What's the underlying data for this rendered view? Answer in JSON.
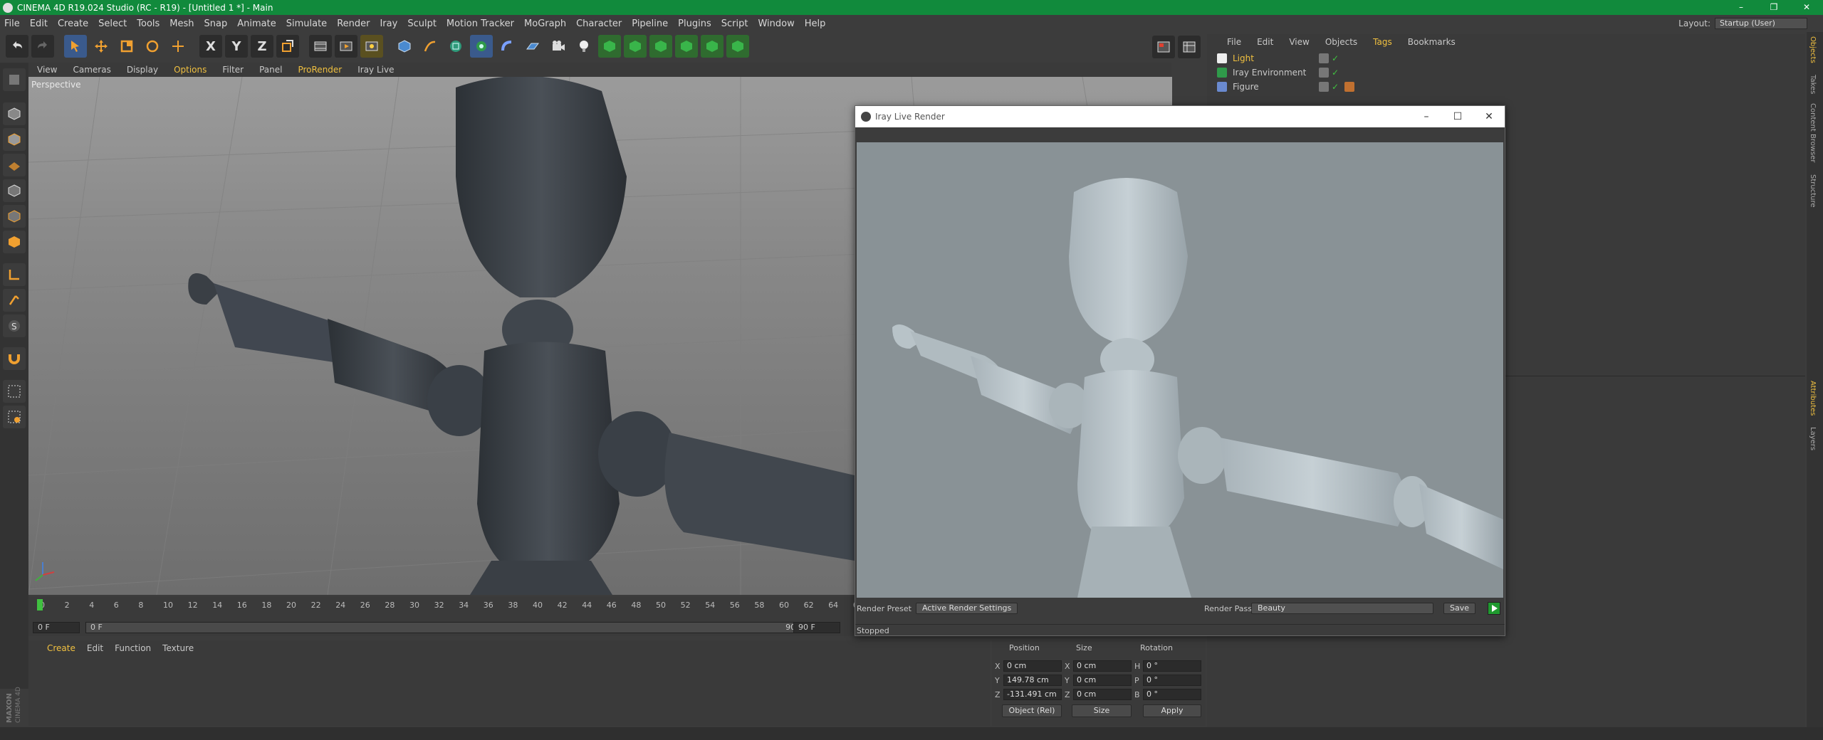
{
  "window": {
    "title": "CINEMA 4D R19.024 Studio (RC - R19) - [Untitled 1 *] - Main",
    "controls": [
      "–",
      "❐",
      "✕"
    ]
  },
  "menubar": {
    "items": [
      "File",
      "Edit",
      "Create",
      "Select",
      "Tools",
      "Mesh",
      "Snap",
      "Animate",
      "Simulate",
      "Render",
      "Iray",
      "Sculpt",
      "Motion Tracker",
      "MoGraph",
      "Character",
      "Pipeline",
      "Plugins",
      "Script",
      "Window",
      "Help"
    ],
    "layout_label": "Layout:",
    "layout_value": "Startup (User)"
  },
  "viewport": {
    "menu": [
      "View",
      "Cameras",
      "Display",
      "Options",
      "Filter",
      "Panel",
      "ProRender",
      "Iray Live"
    ],
    "label": "Perspective"
  },
  "timeline": {
    "ticks": [
      "0",
      "2",
      "4",
      "6",
      "8",
      "10",
      "12",
      "14",
      "16",
      "18",
      "20",
      "22",
      "24",
      "26",
      "28",
      "30",
      "32",
      "34",
      "36",
      "38",
      "40",
      "42",
      "44",
      "46",
      "48",
      "50",
      "52",
      "54",
      "56",
      "58",
      "60",
      "62",
      "64",
      "66"
    ],
    "current_frame": "0 F",
    "start_frame": "0 F",
    "end_frame_slider": "90 F",
    "end_frame": "90 F"
  },
  "material_panel": {
    "menu": [
      "Create",
      "Edit",
      "Function",
      "Texture"
    ]
  },
  "coordinates": {
    "headers": [
      "Position",
      "Size",
      "Rotation"
    ],
    "rows": [
      {
        "axis": "X",
        "pos": "0 cm",
        "size_axis": "X",
        "size": "0 cm",
        "rot_axis": "H",
        "rot": "0 °"
      },
      {
        "axis": "Y",
        "pos": "149.78 cm",
        "size_axis": "Y",
        "size": "0 cm",
        "rot_axis": "P",
        "rot": "0 °"
      },
      {
        "axis": "Z",
        "pos": "-131.491 cm",
        "size_axis": "Z",
        "size": "0 cm",
        "rot_axis": "B",
        "rot": "0 °"
      }
    ],
    "mode": "Object (Rel)",
    "size_mode": "Size",
    "apply": "Apply"
  },
  "object_manager": {
    "menu": [
      "File",
      "Edit",
      "View",
      "Objects",
      "Tags",
      "Bookmarks"
    ],
    "objects": [
      {
        "name": "Light",
        "highlight": true
      },
      {
        "name": "Iray Environment",
        "highlight": false
      },
      {
        "name": "Figure",
        "highlight": false
      }
    ]
  },
  "right_tabs": [
    "Objects",
    "Takes",
    "Content Browser",
    "Structure",
    "Attributes",
    "Layers"
  ],
  "iray_window": {
    "title": "Iray Live Render",
    "render_preset_label": "Render Preset",
    "render_preset_value": "Active Render Settings",
    "render_pass_label": "Render Pass",
    "render_pass_value": "Beauty",
    "save": "Save",
    "status": "Stopped"
  },
  "brand": "MAXON CINEMA 4D",
  "colors": {
    "titlebar": "#118a3c",
    "accent": "#f0c040",
    "render_bg": "#899296"
  }
}
